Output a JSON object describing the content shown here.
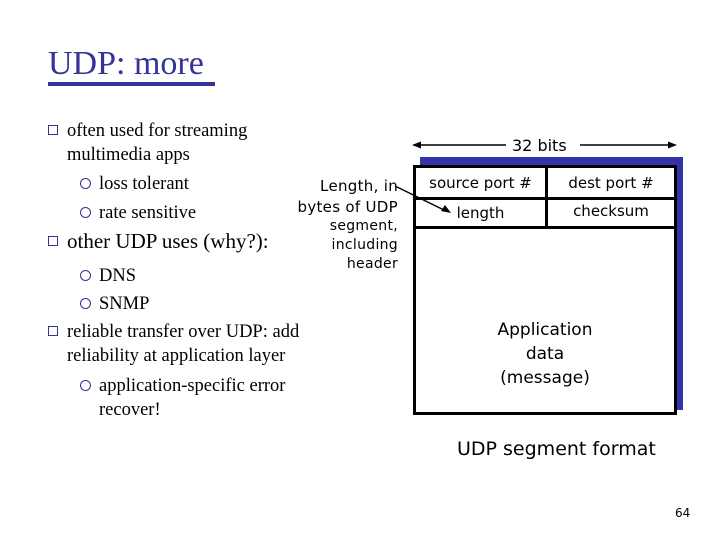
{
  "slide": {
    "title": "UDP: more",
    "page_number": "64",
    "accent_color": "#33339a"
  },
  "bullets": {
    "b1_line1": "often used for streaming",
    "b1_line2": "multimedia apps",
    "b1_sub1": "loss tolerant",
    "b1_sub2": "rate sensitive",
    "b2": "other UDP uses (why?):",
    "b2_sub1": "DNS",
    "b2_sub2": "SNMP",
    "b3_line1": "reliable transfer over UDP: add",
    "b3_line2": "reliability at application layer",
    "b3_sub1_line1": "application-specific error",
    "b3_sub1_line2": "recover!"
  },
  "annotation": {
    "line1": "Length, in",
    "line2": "bytes of UDP",
    "line3": "segment,",
    "line4": "including",
    "line5": "header"
  },
  "diagram": {
    "width_label": "32 bits",
    "fields": {
      "source_port": "source port #",
      "dest_port": "dest port #",
      "length": "length",
      "checksum": "checksum"
    },
    "payload_line1": "Application",
    "payload_line2": "data",
    "payload_line3": "(message)",
    "caption": "UDP segment format",
    "shadow_color": "#3434a8"
  }
}
